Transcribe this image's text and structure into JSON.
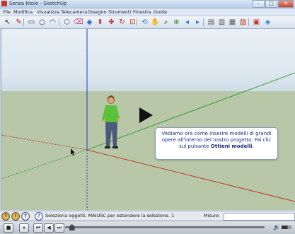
{
  "window": {
    "title": "Senza titolo - SketchUp",
    "buttons": {
      "minimize": "–",
      "maximize": "□",
      "close": "✕"
    }
  },
  "menubar": {
    "items": [
      "File",
      "Modifica",
      "Visualizza",
      "Telecamera",
      "Disegno",
      "Strumenti",
      "Finestra",
      "Guide"
    ]
  },
  "toolbar": {
    "tools": [
      {
        "name": "select-tool",
        "glyph": "↖",
        "color": "#222222"
      },
      {
        "name": "line-tool",
        "glyph": "✎",
        "color": "#b02020"
      },
      {
        "name": "rectangle-tool",
        "glyph": "▭",
        "color": "#333333"
      },
      {
        "name": "circle-tool",
        "glyph": "○",
        "color": "#333333"
      },
      {
        "name": "arc-tool",
        "glyph": "◠",
        "color": "#333333"
      },
      {
        "name": "component-tool",
        "glyph": "⬡",
        "color": "#555555"
      },
      {
        "name": "eraser-tool",
        "glyph": "⌫",
        "color": "#c04080"
      },
      {
        "name": "paint-bucket-tool",
        "glyph": "◆",
        "color": "#3a6fd0"
      },
      {
        "name": "pushpull-tool",
        "glyph": "⬍",
        "color": "#b03030"
      },
      {
        "name": "move-tool",
        "glyph": "✥",
        "color": "#c02020"
      },
      {
        "name": "rotate-tool",
        "glyph": "↻",
        "color": "#c02020"
      },
      {
        "name": "offset-tool",
        "glyph": "⊡",
        "color": "#c04020"
      },
      {
        "name": "orbit-tool",
        "glyph": "⟲",
        "color": "#2a7ad0"
      },
      {
        "name": "pan-tool",
        "glyph": "✋",
        "color": "#444444"
      },
      {
        "name": "zoom-tool",
        "glyph": "⌕",
        "color": "#333333"
      },
      {
        "name": "zoom-extents-tool",
        "glyph": "⊕",
        "color": "#3a8a3a"
      },
      {
        "name": "previous-view-tool",
        "glyph": "◂",
        "color": "#2a7ad0"
      },
      {
        "name": "next-view-tool",
        "glyph": "▸",
        "color": "#2a7ad0"
      },
      {
        "name": "get-models-tool",
        "glyph": "▤",
        "color": "#5a5a5a"
      },
      {
        "name": "share-model-tool",
        "glyph": "▥",
        "color": "#5a5a5a"
      },
      {
        "name": "share-component-tool",
        "glyph": "▦",
        "color": "#5a5a5a"
      },
      {
        "name": "extension-warehouse-tool",
        "glyph": "▧",
        "color": "#c04020"
      },
      {
        "name": "layout-tool",
        "glyph": "▣",
        "color": "#c03030"
      },
      {
        "name": "extra-tool",
        "glyph": "◈",
        "color": "#2a7ad0"
      }
    ]
  },
  "viewport": {
    "tooltip": {
      "line1": "Vediamo ora come inserire modelli di grandi",
      "line2": "opere all'interno del nostro progetto. Fai clic",
      "line3_prefix": "sul pulsante ",
      "line3_bold": "Ottieni modelli",
      "line3_suffix": "."
    },
    "colors": {
      "sky_top": "#e9f0f6",
      "ground": "#b7c7a8",
      "axis_red": "#c0392b",
      "axis_green": "#3a9a3a",
      "axis_blue": "#2a3ab0"
    }
  },
  "statusbar": {
    "message": "Seleziona oggetti. MAIUSC per estendere la selezione. 1",
    "misure_label": "Misure",
    "misure_value": "",
    "icons": [
      "help-icon",
      "geo-location-icon",
      "credits-icon"
    ]
  },
  "player": {
    "buttons": {
      "stop": "■",
      "pause": "⏸",
      "prev": "⏮",
      "rewind": "◀",
      "forward": "▶",
      "next": "⏭"
    },
    "progress": 0.02,
    "volume_icon": "🔊"
  }
}
